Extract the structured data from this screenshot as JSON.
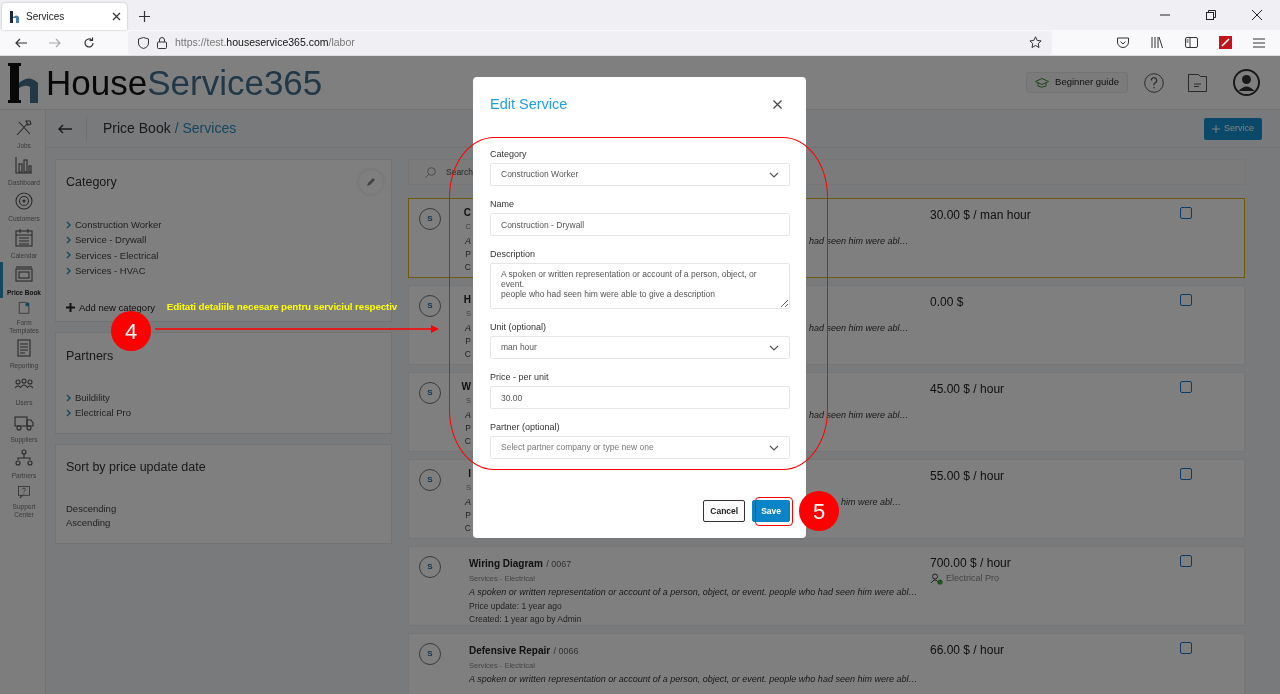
{
  "browser": {
    "tab": {
      "title": "Services"
    },
    "url": {
      "scheme": "https://test.",
      "domain": "houseservice365.com",
      "path": "/labor"
    }
  },
  "header": {
    "logo": {
      "first": "House",
      "second": "Service365"
    },
    "guide_button": "Beginner guide"
  },
  "sidebar": {
    "items": [
      {
        "label": "Jobs",
        "selected": false
      },
      {
        "label": "Dashboard",
        "selected": false
      },
      {
        "label": "Customers",
        "selected": false
      },
      {
        "label": "Calendar",
        "selected": false
      },
      {
        "label": "Price Book",
        "selected": true
      },
      {
        "label": "Form Templates",
        "selected": false
      },
      {
        "label": "Reporting",
        "selected": false
      },
      {
        "label": "Users",
        "selected": false
      },
      {
        "label": "Suppliers",
        "selected": false
      },
      {
        "label": "Partners",
        "selected": false
      },
      {
        "label": "Support Center",
        "selected": false
      }
    ]
  },
  "breadcrumb": {
    "parent": "Price Book",
    "current": "/ Services"
  },
  "add_button": "Service",
  "category_panel": {
    "title": "Category",
    "items": [
      "Construction Worker",
      "Service - Drywall",
      "Services - Electrical",
      "Services - HVAC"
    ],
    "add_label": "Add new category"
  },
  "partners_panel": {
    "title": "Partners",
    "items": [
      "Buildility",
      "Electrical Pro"
    ]
  },
  "sort_panel": {
    "title": "Sort by price update date",
    "options": [
      "Descending",
      "Ascending"
    ]
  },
  "search": {
    "placeholder": "Search"
  },
  "services": [
    {
      "kind": "covered",
      "selected": true,
      "initial": "S",
      "name": "C",
      "category": "C",
      "description_start": "A",
      "description_end": "had seen him were abl…",
      "price_update": "P",
      "created": "C",
      "price": "30.00 $ / man hour",
      "checked": false
    },
    {
      "kind": "covered",
      "selected": false,
      "initial": "S",
      "name": "H",
      "category": "S",
      "description_start": "A",
      "description_end": "had seen him were abl…",
      "price_update": "P",
      "created": "C",
      "price": "0.00 $",
      "checked": false
    },
    {
      "kind": "covered",
      "selected": false,
      "initial": "S",
      "name": "W",
      "category": "S",
      "description_start": "A",
      "description_end": "had seen him were abl…",
      "price_update": "P",
      "created": "C",
      "price": "45.00 $ / hour",
      "checked": false
    },
    {
      "kind": "covered",
      "selected": false,
      "initial": "S",
      "name": "I",
      "category": "S",
      "description_start": "A",
      "description_end": "him were abl…",
      "price_update": "P",
      "created": "C",
      "price": "55.00 $ / hour",
      "checked": false
    },
    {
      "kind": "full",
      "selected": false,
      "initial": "S",
      "name": "Wiring Diagram",
      "code": "/ 0067",
      "category": "Services - Electrical",
      "description": "A spoken or written representation or account of a person, object, or event. people who had seen him were abl…",
      "price_update": "Price update: 1 year ago",
      "created": "Created: 1 year ago by Admin",
      "price": "700.00 $ / hour",
      "partner": "Electrical Pro",
      "checked": false
    },
    {
      "kind": "full",
      "selected": false,
      "initial": "S",
      "name": "Defensive Repair",
      "code": "/ 0066",
      "category": "Services - Electrical",
      "description": "A spoken or written representation or account of a person, object, or event. people who had seen him were abl…",
      "price": "66.00 $ / hour",
      "checked": false
    }
  ],
  "modal": {
    "title": "Edit Service",
    "fields": [
      {
        "kind": "select",
        "label": "Category",
        "value": "Construction Worker"
      },
      {
        "kind": "text",
        "label": "Name",
        "value": "Construction - Drywall"
      },
      {
        "kind": "textarea",
        "label": "Description",
        "value": "A spoken or written representation or account of a person, object, or event.\npeople who had seen him were able to give a description"
      },
      {
        "kind": "select",
        "label": "Unit (optional)",
        "value": "man hour"
      },
      {
        "kind": "text",
        "label": "Price - per unit",
        "value": "30.00"
      },
      {
        "kind": "select",
        "label": "Partner (optional)",
        "placeholder": "Select partner company or type new one"
      }
    ],
    "buttons": [
      {
        "kind": "secondary",
        "label": "Cancel"
      },
      {
        "kind": "primary",
        "label": "Save"
      }
    ]
  },
  "annotations": [
    {
      "kind": "step",
      "number": "4",
      "text": "Editati detaliile necesare pentru serviciul respectiv"
    },
    {
      "kind": "step",
      "number": "5"
    }
  ]
}
